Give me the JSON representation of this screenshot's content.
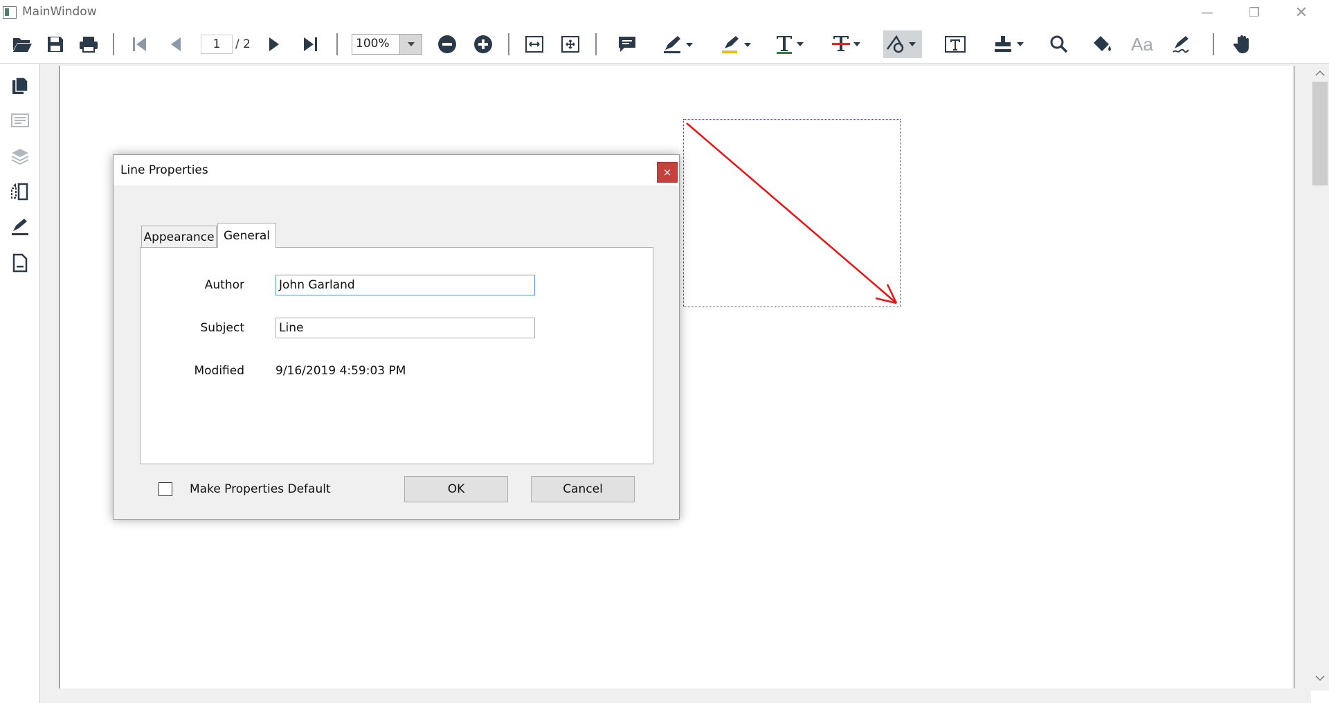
{
  "window": {
    "title": "MainWindow",
    "minimize": "—",
    "restore": "❐",
    "close": "✕"
  },
  "toolbar": {
    "page_current": "1",
    "page_total": "/ 2",
    "zoom": "100%"
  },
  "dialog": {
    "title": "Line Properties",
    "close": "×",
    "tabs": [
      {
        "label": "Appearance",
        "selected": false
      },
      {
        "label": "General",
        "selected": true
      }
    ],
    "fields": {
      "author_label": "Author",
      "author_value": "John Garland",
      "subject_label": "Subject",
      "subject_value": "Line",
      "modified_label": "Modified",
      "modified_value": "9/16/2019 4:59:03 PM"
    },
    "make_default_label": "Make Properties Default",
    "ok_label": "OK",
    "cancel_label": "Cancel"
  },
  "colors": {
    "annotation_line": "#ee1111",
    "selection_border": "#3a3ad0",
    "close_button": "#c5413b",
    "icon": "#2b3a4a"
  }
}
